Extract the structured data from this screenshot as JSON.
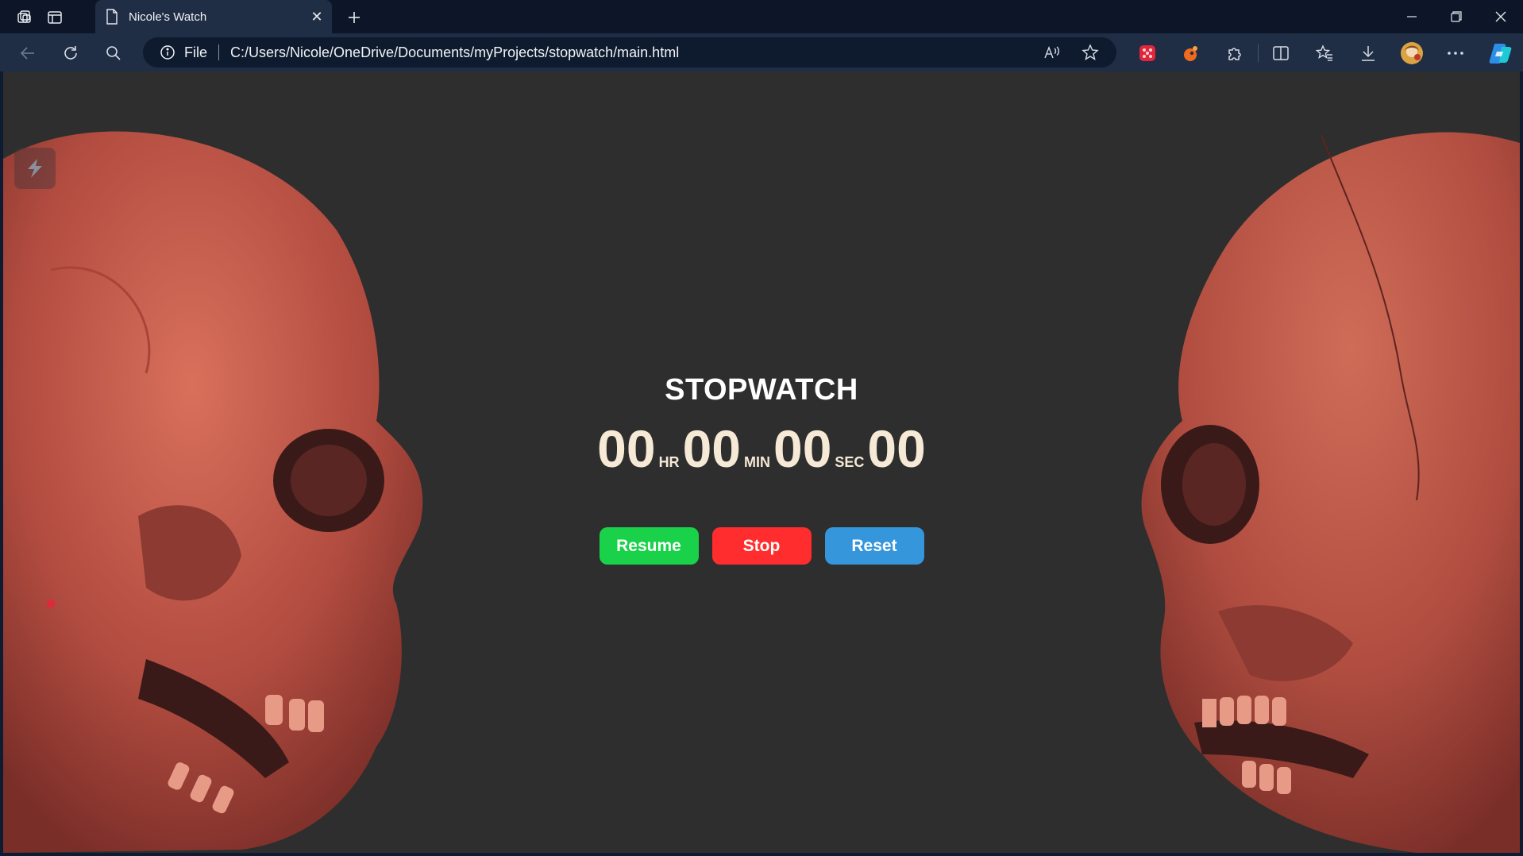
{
  "browser": {
    "tab": {
      "title": "Nicole's Watch",
      "close_glyph": "✕"
    },
    "new_tab_glyph": "+",
    "address": {
      "scheme": "File",
      "url": "C:/Users/Nicole/OneDrive/Documents/myProjects/stopwatch/main.html"
    },
    "icons": {
      "workspaces": "workspaces-icon",
      "tab_actions": "tab-actions-icon",
      "back": "back-arrow-icon",
      "refresh": "refresh-icon",
      "search": "search-icon",
      "info": "info-icon",
      "read_aloud": "read-aloud-icon",
      "favorite": "star-icon",
      "ext1": "game-extension-icon",
      "ext2": "orange-extension-icon",
      "extensions": "puzzle-icon",
      "split": "split-screen-icon",
      "favorites": "favorites-icon",
      "downloads": "download-icon",
      "profile": "avatar",
      "more": "more-icon",
      "copilot": "copilot-icon"
    }
  },
  "page": {
    "title": "STOPWATCH",
    "time": {
      "hours": "00",
      "hours_unit": "HR",
      "minutes": "00",
      "minutes_unit": "MIN",
      "seconds": "00",
      "seconds_unit": "SEC",
      "centiseconds": "00"
    },
    "buttons": {
      "resume": "Resume",
      "stop": "Stop",
      "reset": "Reset"
    },
    "colors": {
      "background": "#2e2e2e",
      "digits": "#f6e9d6",
      "resume": "#19d24a",
      "stop": "#ff2d2d",
      "reset": "#3596dc",
      "skull": "#c4584a"
    }
  }
}
